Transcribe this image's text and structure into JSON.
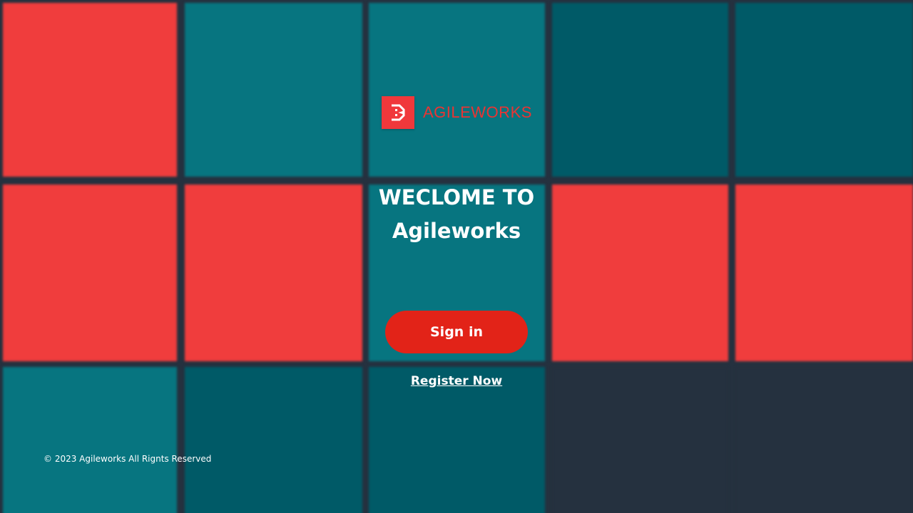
{
  "colors": {
    "background": "#25313f",
    "tile_red": "#f03d3d",
    "tile_teal": "#077580",
    "tile_dark_teal": "#005a67",
    "button": "#e22318",
    "logo_red": "#ea3433"
  },
  "tiles": [
    "tile_red",
    "tile_teal",
    "tile_teal",
    "tile_dark_teal",
    "tile_dark_teal",
    "tile_red",
    "tile_red",
    "tile_teal",
    "tile_red",
    "tile_red",
    "tile_teal",
    "tile_dark_teal",
    "tile_dark_teal",
    "background",
    "background"
  ],
  "logo": {
    "icon": "agileworks-logo-icon",
    "wordmark": "AGILEWORKS"
  },
  "welcome": {
    "line1": "WECLOME TO",
    "line2": "Agileworks"
  },
  "signin_button": "Sign in",
  "register_link": "Register Now",
  "footer": "© 2023 Agileworks All Rignts Reserved"
}
